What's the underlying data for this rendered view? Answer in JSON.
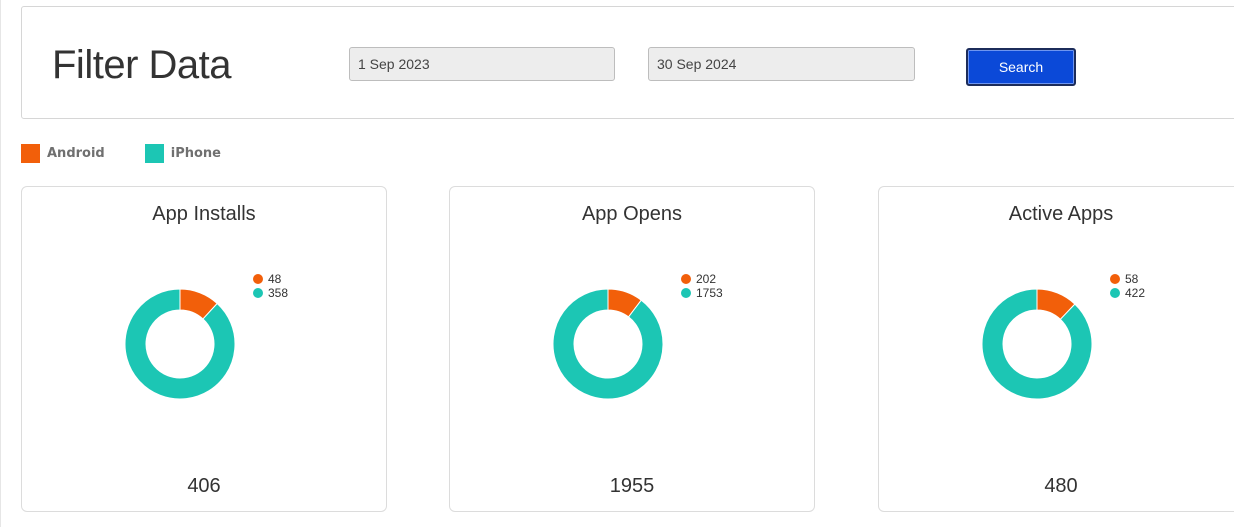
{
  "filter": {
    "title": "Filter Data",
    "date_from": "1 Sep 2023",
    "date_to": "30 Sep 2024",
    "search_label": "Search"
  },
  "legend": {
    "android": "Android",
    "iphone": "iPhone"
  },
  "colors": {
    "android": "#f25f0a",
    "iphone": "#1cc6b4"
  },
  "chart_data": [
    {
      "type": "pie",
      "title": "App Installs",
      "categories": [
        "Android",
        "iPhone"
      ],
      "values": [
        48,
        358
      ],
      "total": "406"
    },
    {
      "type": "pie",
      "title": "App Opens",
      "categories": [
        "Android",
        "iPhone"
      ],
      "values": [
        202,
        1753
      ],
      "total": "1955"
    },
    {
      "type": "pie",
      "title": "Active Apps",
      "categories": [
        "Android",
        "iPhone"
      ],
      "values": [
        58,
        422
      ],
      "total": "480"
    }
  ]
}
